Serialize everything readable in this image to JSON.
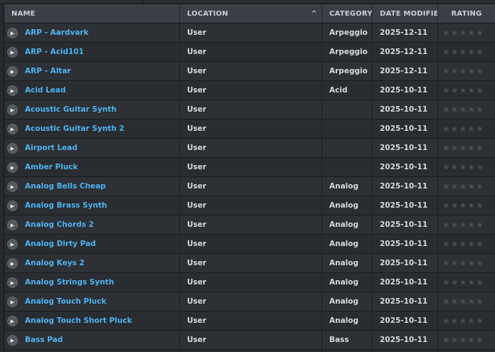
{
  "columns": {
    "name": "NAME",
    "location": "LOCATION",
    "category": "CATEGORY",
    "date_modified": "DATE MODIFIED",
    "rating": "RATING"
  },
  "sort": {
    "column": "location",
    "direction": "ascending"
  },
  "rows": [
    {
      "name": "ARP - Aardvark",
      "location": "User",
      "category": "Arpeggio",
      "date": "2025-12-11",
      "rating": 0
    },
    {
      "name": "ARP - Acid101",
      "location": "User",
      "category": "Arpeggio",
      "date": "2025-12-11",
      "rating": 0
    },
    {
      "name": "ARP - Altar",
      "location": "User",
      "category": "Arpeggio",
      "date": "2025-12-11",
      "rating": 0
    },
    {
      "name": "Acid Lead",
      "location": "User",
      "category": "Acid",
      "date": "2025-10-11",
      "rating": 0
    },
    {
      "name": "Acoustic Guitar Synth",
      "location": "User",
      "category": "",
      "date": "2025-10-11",
      "rating": 0
    },
    {
      "name": "Acoustic Guitar Synth 2",
      "location": "User",
      "category": "",
      "date": "2025-10-11",
      "rating": 0
    },
    {
      "name": "Airport Lead",
      "location": "User",
      "category": "",
      "date": "2025-10-11",
      "rating": 0
    },
    {
      "name": "Amber Pluck",
      "location": "User",
      "category": "",
      "date": "2025-10-11",
      "rating": 0
    },
    {
      "name": "Analog Bells Cheap",
      "location": "User",
      "category": "Analog",
      "date": "2025-10-11",
      "rating": 0
    },
    {
      "name": "Analog Brass Synth",
      "location": "User",
      "category": "Analog",
      "date": "2025-10-11",
      "rating": 0
    },
    {
      "name": "Analog Chords 2",
      "location": "User",
      "category": "Analog",
      "date": "2025-10-11",
      "rating": 0
    },
    {
      "name": "Analog Dirty Pad",
      "location": "User",
      "category": "Analog",
      "date": "2025-10-11",
      "rating": 0
    },
    {
      "name": "Analog Keys 2",
      "location": "User",
      "category": "Analog",
      "date": "2025-10-11",
      "rating": 0
    },
    {
      "name": "Analog Strings Synth",
      "location": "User",
      "category": "Analog",
      "date": "2025-10-11",
      "rating": 0
    },
    {
      "name": "Analog Touch Pluck",
      "location": "User",
      "category": "Analog",
      "date": "2025-10-11",
      "rating": 0
    },
    {
      "name": "Analog Touch Short Pluck",
      "location": "User",
      "category": "Analog",
      "date": "2025-10-11",
      "rating": 0
    },
    {
      "name": "Bass Pad",
      "location": "User",
      "category": "Bass",
      "date": "2025-10-11",
      "rating": 0
    },
    {
      "name": "",
      "location": "",
      "category": "",
      "date": "",
      "rating": 0
    }
  ],
  "rating_max": 5,
  "icons": {
    "play": "play-icon",
    "star": "star-icon",
    "sort": "sort-ascending-icon"
  },
  "colors": {
    "preset_name": "#4db3f0",
    "star_empty": "#4a4e54",
    "header_bg": "#3c4046"
  }
}
